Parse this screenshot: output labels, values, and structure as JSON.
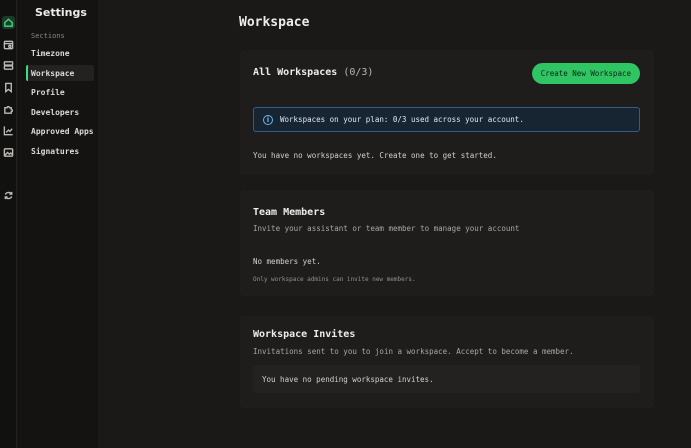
{
  "rail": {
    "icons": [
      {
        "name": "home-icon",
        "active": true
      },
      {
        "name": "calendar-icon",
        "active": false
      },
      {
        "name": "server-icon",
        "active": false
      },
      {
        "name": "bookmark-icon",
        "active": false
      },
      {
        "name": "puzzle-icon",
        "active": false
      },
      {
        "name": "chart-icon",
        "active": false
      },
      {
        "name": "image-icon",
        "active": false
      },
      {
        "name": "refresh-icon",
        "active": false
      }
    ]
  },
  "sidebar": {
    "title": "Settings",
    "section_label": "Sections",
    "items": [
      {
        "label": "Timezone",
        "active": false
      },
      {
        "label": "Workspace",
        "active": true
      },
      {
        "label": "Profile",
        "active": false
      },
      {
        "label": "Developers",
        "active": false
      },
      {
        "label": "Approved Apps",
        "active": false
      },
      {
        "label": "Signatures",
        "active": false
      }
    ]
  },
  "page": {
    "title": "Workspace"
  },
  "workspaces": {
    "title": "All Workspaces",
    "count": "(0/3)",
    "create_button": "Create New Workspace",
    "info": "Workspaces on your plan: 0/3 used across your account.",
    "empty": "You have no workspaces yet. Create one to get started."
  },
  "members": {
    "title": "Team Members",
    "subtitle": "Invite your assistant or team member to manage your account",
    "empty": "No members yet.",
    "note": "Only workspace admins can invite new members."
  },
  "invites": {
    "title": "Workspace Invites",
    "subtitle": "Invitations sent to you to join a workspace. Accept to become a member.",
    "empty": "You have no pending workspace invites."
  },
  "colors": {
    "accent": "#2ec562",
    "info_border": "#2f5f86",
    "background": "#1a1918"
  }
}
